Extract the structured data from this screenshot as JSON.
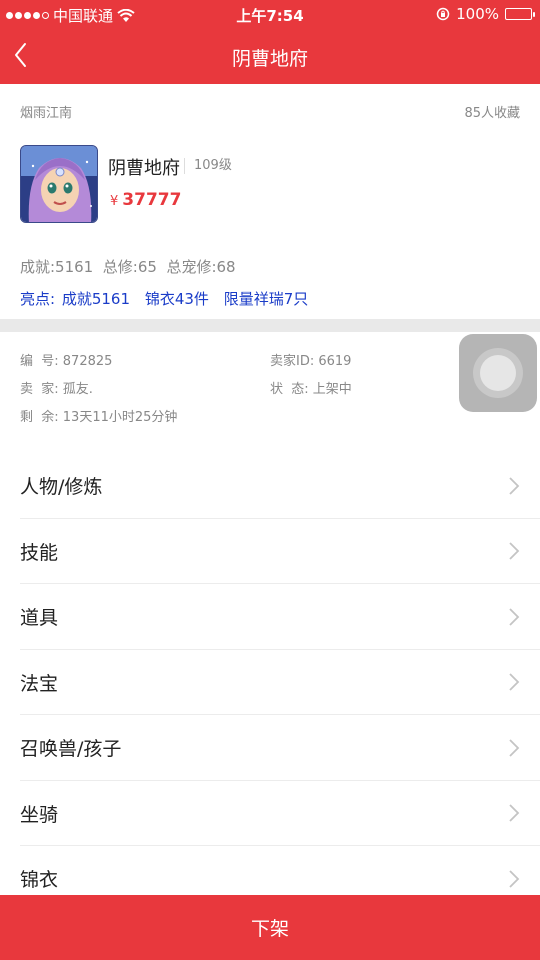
{
  "status_bar": {
    "carrier": "中国联通",
    "time": "上午7:54",
    "battery": "100%",
    "icons": [
      "signal-dots-icon",
      "wifi-icon",
      "orientation-lock-icon",
      "battery-icon"
    ]
  },
  "nav": {
    "title": "阴曹地府",
    "back_icon": "chevron-left-icon"
  },
  "card": {
    "server": "烟雨江南",
    "favorites": "85人收藏",
    "name": "阴曹地府",
    "level": "109级",
    "price_symbol": "¥",
    "price": "37777",
    "stats": "成就:5161  总修:65  总宠修:68",
    "highlights_label": "亮点:",
    "highlights": [
      "成就5161",
      "锦衣43件",
      "限量祥瑞7只"
    ]
  },
  "info": {
    "serial": "编  号: 872825",
    "seller_id": "卖家ID: 6619",
    "seller": "卖  家: 孤友.",
    "status": "状  态: 上架中",
    "remaining": "剩  余: 13天11小时25分钟"
  },
  "menu": [
    {
      "label": "人物/修炼"
    },
    {
      "label": "技能"
    },
    {
      "label": "道具"
    },
    {
      "label": "法宝"
    },
    {
      "label": "召唤兽/孩子"
    },
    {
      "label": "坐骑"
    },
    {
      "label": "锦衣"
    }
  ],
  "bottom_button": "下架",
  "colors": {
    "brand_red": "#e8383d",
    "highlight_blue": "#1a3cc8"
  }
}
